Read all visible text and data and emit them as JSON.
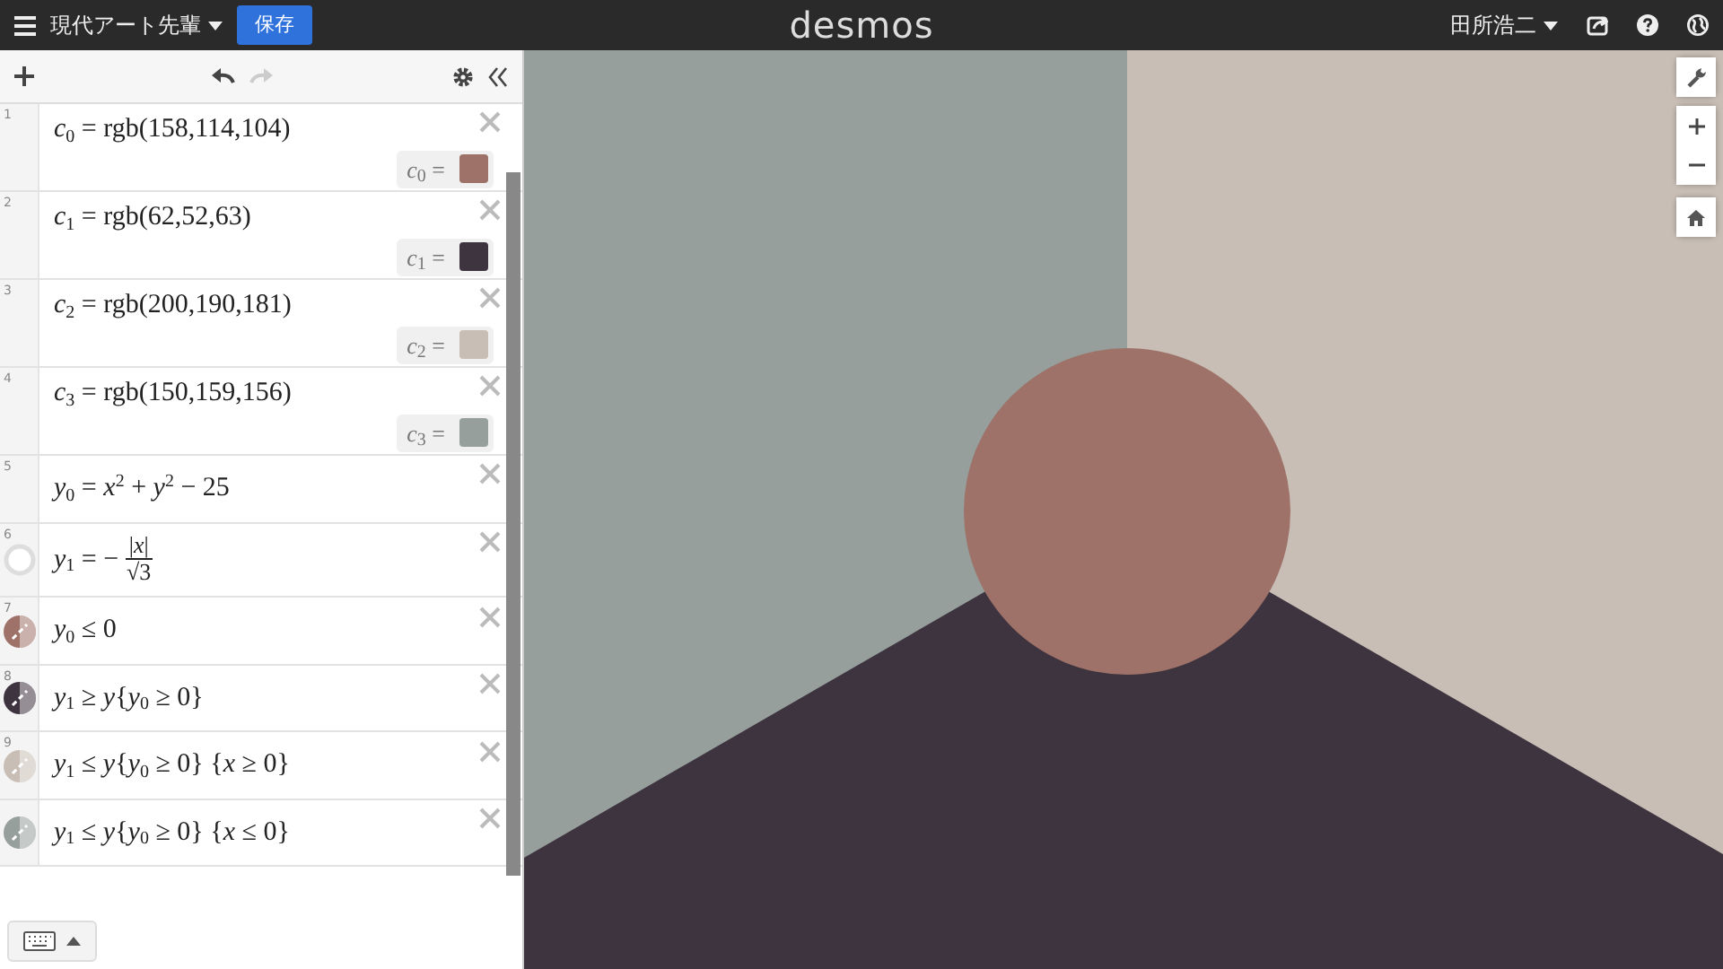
{
  "header": {
    "title": "現代アート先輩",
    "save_button": "保存",
    "logo": "desmos",
    "user": "田所浩二"
  },
  "expressions": [
    {
      "number": "1",
      "kind": "color",
      "latex": "*c*$_{0}$ = rgb(158,114,104)",
      "swatch_label": "*c*$_{0}$ =",
      "color": "#9e7268"
    },
    {
      "number": "2",
      "kind": "color",
      "latex": "*c*$_{1}$ = rgb(62,52,63)",
      "swatch_label": "*c*$_{1}$ =",
      "color": "#3e343f"
    },
    {
      "number": "3",
      "kind": "color",
      "latex": "*c*$_{2}$ = rgb(200,190,181)",
      "swatch_label": "*c*$_{2}$ =",
      "color": "#c8beb5"
    },
    {
      "number": "4",
      "kind": "color",
      "latex": "*c*$_{3}$ = rgb(150,159,156)",
      "swatch_label": "*c*$_{3}$ =",
      "color": "#969f9c"
    },
    {
      "number": "5",
      "kind": "plain",
      "latex": "*y*$_{0}$ = *x*$^{2}$ + *y*$^{2}$ − 25"
    },
    {
      "number": "6",
      "kind": "hidden",
      "latex": "*y*$_{1}$ = −",
      "numerator": "|*x*|",
      "denominator": "√3"
    },
    {
      "number": "7",
      "kind": "region",
      "latex": "*y*$_{0}$ ≤ 0",
      "color": "#9e7268"
    },
    {
      "number": "8",
      "kind": "region",
      "latex": "*y*$_{1}$ ≥ *y*{*y*$_{0}$ ≥ 0}",
      "color": "#3e343f"
    },
    {
      "number": "9",
      "kind": "region",
      "latex": "*y*$_{1}$ ≤ *y*{*y*$_{0}$ ≥ 0} {*x* ≥ 0}",
      "color": "#c8beb5"
    },
    {
      "kind": "region",
      "latex": "*y*$_{1}$ ≤ *y*{*y*$_{0}$ ≥ 0} {*x* ≤ 0}",
      "color": "#969f9c"
    }
  ]
}
